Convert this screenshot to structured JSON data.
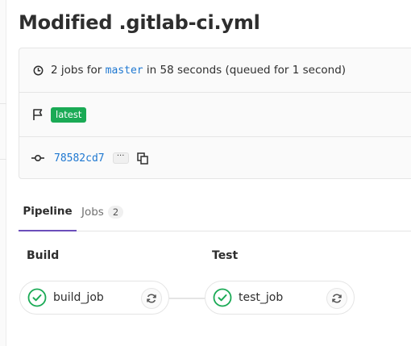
{
  "page": {
    "title": "Modified .gitlab-ci.yml"
  },
  "info": {
    "jobs_summary_prefix": "2 jobs for",
    "branch": "master",
    "jobs_summary_suffix": "in 58 seconds (queued for 1 second)",
    "badge": "latest",
    "commit_sha": "78582cd7",
    "dots_label": "···"
  },
  "tabs": {
    "pipeline_label": "Pipeline",
    "jobs_label": "Jobs",
    "jobs_count": "2"
  },
  "stages": [
    {
      "title": "Build",
      "job": "build_job",
      "status": "passed"
    },
    {
      "title": "Test",
      "job": "test_job",
      "status": "passed"
    }
  ],
  "colors": {
    "success": "#1aaa55",
    "link": "#1f78d1",
    "tab_underline": "#6b4fbb"
  },
  "icons": {
    "clock": "clock-icon",
    "flag": "flag-icon",
    "commit": "commit-icon",
    "copy": "copy-icon",
    "status": "status-success-icon",
    "retry": "retry-icon"
  }
}
